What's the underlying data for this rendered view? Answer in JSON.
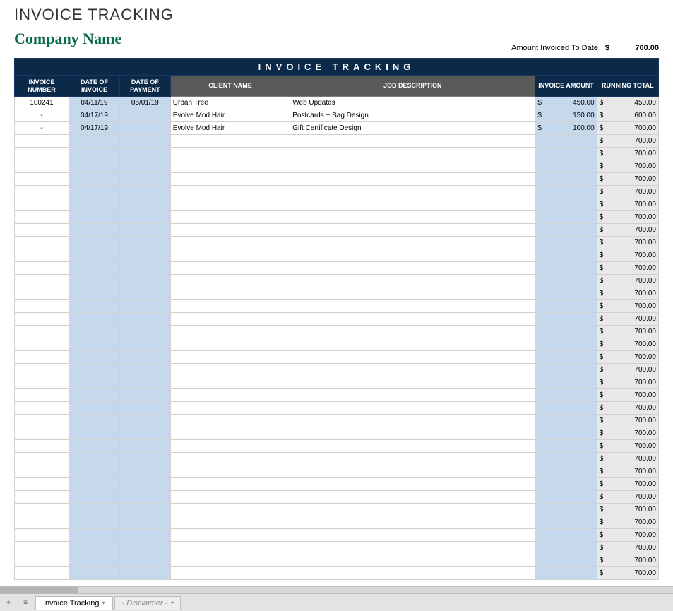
{
  "title": "INVOICE TRACKING",
  "company": "Company Name",
  "summary": {
    "label": "Amount Invoiced To Date",
    "currency": "$",
    "value": "700.00"
  },
  "banner": "INVOICE TRACKING",
  "headers": {
    "invoice_number": "INVOICE NUMBER",
    "date_invoice": "DATE OF INVOICE",
    "date_payment": "DATE OF PAYMENT",
    "client_name": "CLIENT NAME",
    "job_description": "JOB DESCRIPTION",
    "invoice_amount": "INVOICE AMOUNT",
    "running_total": "RUNNING TOTAL"
  },
  "rows": [
    {
      "inv": "100241",
      "di": "04/11/19",
      "dp": "05/01/19",
      "client": "Urban Tree",
      "job": "Web Updates",
      "amt": "450.00",
      "run": "450.00"
    },
    {
      "inv": "-",
      "di": "04/17/19",
      "dp": "",
      "client": "Evolve Mod Hair",
      "job": "Postcards + Bag Design",
      "amt": "150.00",
      "run": "600.00"
    },
    {
      "inv": "-",
      "di": "04/17/19",
      "dp": "",
      "client": "Evolve Mod Hair",
      "job": "Gift Certificate Design",
      "amt": "100.00",
      "run": "700.00"
    },
    {
      "inv": "",
      "di": "",
      "dp": "",
      "client": "",
      "job": "",
      "amt": "",
      "run": "700.00"
    },
    {
      "inv": "",
      "di": "",
      "dp": "",
      "client": "",
      "job": "",
      "amt": "",
      "run": "700.00"
    },
    {
      "inv": "",
      "di": "",
      "dp": "",
      "client": "",
      "job": "",
      "amt": "",
      "run": "700.00"
    },
    {
      "inv": "",
      "di": "",
      "dp": "",
      "client": "",
      "job": "",
      "amt": "",
      "run": "700.00"
    },
    {
      "inv": "",
      "di": "",
      "dp": "",
      "client": "",
      "job": "",
      "amt": "",
      "run": "700.00"
    },
    {
      "inv": "",
      "di": "",
      "dp": "",
      "client": "",
      "job": "",
      "amt": "",
      "run": "700.00"
    },
    {
      "inv": "",
      "di": "",
      "dp": "",
      "client": "",
      "job": "",
      "amt": "",
      "run": "700.00"
    },
    {
      "inv": "",
      "di": "",
      "dp": "",
      "client": "",
      "job": "",
      "amt": "",
      "run": "700.00"
    },
    {
      "inv": "",
      "di": "",
      "dp": "",
      "client": "",
      "job": "",
      "amt": "",
      "run": "700.00"
    },
    {
      "inv": "",
      "di": "",
      "dp": "",
      "client": "",
      "job": "",
      "amt": "",
      "run": "700.00"
    },
    {
      "inv": "",
      "di": "",
      "dp": "",
      "client": "",
      "job": "",
      "amt": "",
      "run": "700.00"
    },
    {
      "inv": "",
      "di": "",
      "dp": "",
      "client": "",
      "job": "",
      "amt": "",
      "run": "700.00"
    },
    {
      "inv": "",
      "di": "",
      "dp": "",
      "client": "",
      "job": "",
      "amt": "",
      "run": "700.00"
    },
    {
      "inv": "",
      "di": "",
      "dp": "",
      "client": "",
      "job": "",
      "amt": "",
      "run": "700.00"
    },
    {
      "inv": "",
      "di": "",
      "dp": "",
      "client": "",
      "job": "",
      "amt": "",
      "run": "700.00"
    },
    {
      "inv": "",
      "di": "",
      "dp": "",
      "client": "",
      "job": "",
      "amt": "",
      "run": "700.00"
    },
    {
      "inv": "",
      "di": "",
      "dp": "",
      "client": "",
      "job": "",
      "amt": "",
      "run": "700.00"
    },
    {
      "inv": "",
      "di": "",
      "dp": "",
      "client": "",
      "job": "",
      "amt": "",
      "run": "700.00"
    },
    {
      "inv": "",
      "di": "",
      "dp": "",
      "client": "",
      "job": "",
      "amt": "",
      "run": "700.00"
    },
    {
      "inv": "",
      "di": "",
      "dp": "",
      "client": "",
      "job": "",
      "amt": "",
      "run": "700.00"
    },
    {
      "inv": "",
      "di": "",
      "dp": "",
      "client": "",
      "job": "",
      "amt": "",
      "run": "700.00"
    },
    {
      "inv": "",
      "di": "",
      "dp": "",
      "client": "",
      "job": "",
      "amt": "",
      "run": "700.00"
    },
    {
      "inv": "",
      "di": "",
      "dp": "",
      "client": "",
      "job": "",
      "amt": "",
      "run": "700.00"
    },
    {
      "inv": "",
      "di": "",
      "dp": "",
      "client": "",
      "job": "",
      "amt": "",
      "run": "700.00"
    },
    {
      "inv": "",
      "di": "",
      "dp": "",
      "client": "",
      "job": "",
      "amt": "",
      "run": "700.00"
    },
    {
      "inv": "",
      "di": "",
      "dp": "",
      "client": "",
      "job": "",
      "amt": "",
      "run": "700.00"
    },
    {
      "inv": "",
      "di": "",
      "dp": "",
      "client": "",
      "job": "",
      "amt": "",
      "run": "700.00"
    },
    {
      "inv": "",
      "di": "",
      "dp": "",
      "client": "",
      "job": "",
      "amt": "",
      "run": "700.00"
    },
    {
      "inv": "",
      "di": "",
      "dp": "",
      "client": "",
      "job": "",
      "amt": "",
      "run": "700.00"
    },
    {
      "inv": "",
      "di": "",
      "dp": "",
      "client": "",
      "job": "",
      "amt": "",
      "run": "700.00"
    },
    {
      "inv": "",
      "di": "",
      "dp": "",
      "client": "",
      "job": "",
      "amt": "",
      "run": "700.00"
    },
    {
      "inv": "",
      "di": "",
      "dp": "",
      "client": "",
      "job": "",
      "amt": "",
      "run": "700.00"
    },
    {
      "inv": "",
      "di": "",
      "dp": "",
      "client": "",
      "job": "",
      "amt": "",
      "run": "700.00"
    },
    {
      "inv": "",
      "di": "",
      "dp": "",
      "client": "",
      "job": "",
      "amt": "",
      "run": "700.00"
    },
    {
      "inv": "",
      "di": "",
      "dp": "",
      "client": "",
      "job": "",
      "amt": "",
      "run": "700.00"
    }
  ],
  "tabs": {
    "add": "+",
    "menu": "≡",
    "active": "Invoice Tracking",
    "other": "- Disclaimer -"
  },
  "currency_symbol": "$"
}
